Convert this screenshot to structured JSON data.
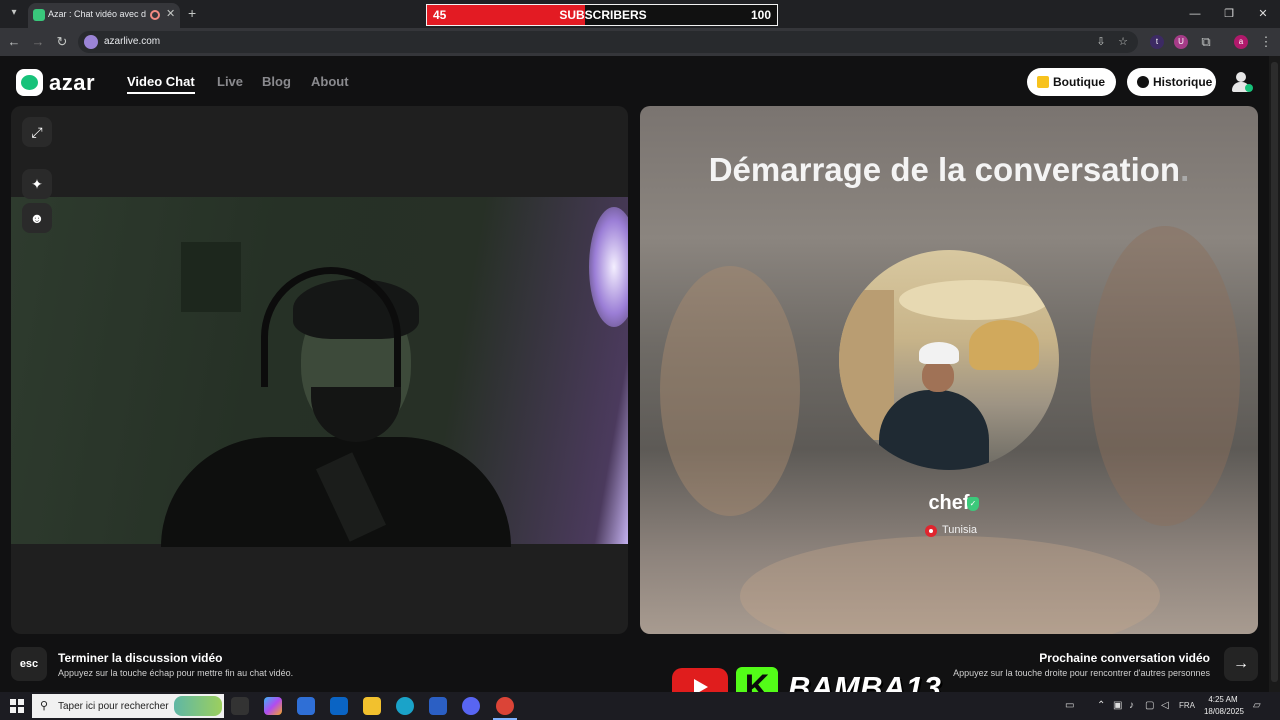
{
  "browser": {
    "tab_title": "Azar : Chat vidéo avec de n",
    "url": "azarlive.com",
    "icons": [
      "tab-list-icon",
      "recording-icon",
      "close-icon",
      "new-tab-icon",
      "back-icon",
      "forward-icon",
      "reload-icon",
      "install-icon",
      "bookmark-star-icon",
      "extensions-icon",
      "menu-icon"
    ],
    "extensions": [
      "t",
      "U",
      "a"
    ]
  },
  "overlay": {
    "sub_current": "45",
    "sub_label": "SUBSCRIBERS",
    "sub_goal": "100",
    "sub_progress": 0.45,
    "handle": "BAMBA13",
    "kick_letter": "K"
  },
  "header": {
    "logo": "azar",
    "nav": [
      {
        "label": "Video Chat",
        "active": true
      },
      {
        "label": "Live",
        "active": false
      },
      {
        "label": "Blog",
        "active": false
      },
      {
        "label": "About",
        "active": false
      }
    ],
    "boutique": "Boutique",
    "historique": "Historique"
  },
  "left_pane": {
    "icons": [
      "expand-icon",
      "sparkle-icon",
      "face-icon"
    ]
  },
  "right_pane": {
    "title": "Démarrage de la conversation",
    "title_dot": ".",
    "partner_name": "chef",
    "country": "Tunisia"
  },
  "footer": {
    "esc_key": "esc",
    "end_title": "Terminer la discussion vidéo",
    "end_desc": "Appuyez sur la touche échap pour mettre fin au chat vidéo.",
    "next_title": "Prochaine conversation vidéo",
    "next_desc": "Appuyez sur la touche droite pour rencontrer d'autres personnes"
  },
  "taskbar": {
    "search_placeholder": "Taper ici pour rechercher",
    "language": "FRA",
    "time": "4:25 AM",
    "date": "18/08/2025",
    "colors": {
      "accent": "#17c27a",
      "youtube": "#e01d1d",
      "kick": "#53fc18",
      "sub_fill": "#e31b23"
    }
  }
}
